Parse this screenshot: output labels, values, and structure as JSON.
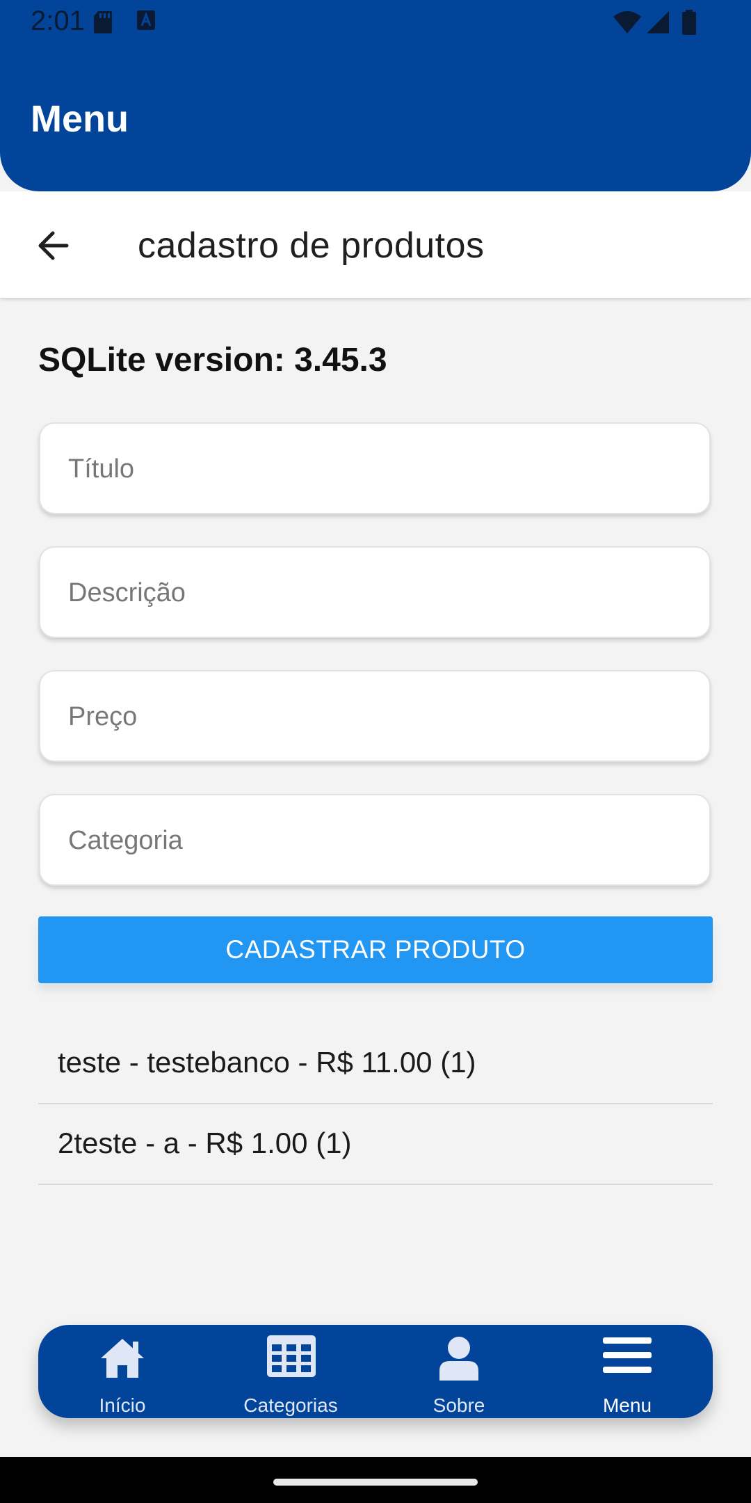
{
  "status_bar": {
    "time": "2:01"
  },
  "header": {
    "title": "Menu"
  },
  "toolbar": {
    "title": "cadastro de produtos"
  },
  "version_text": "SQLite version: 3.45.3",
  "form": {
    "titulo_placeholder": "Título",
    "descricao_placeholder": "Descrição",
    "preco_placeholder": "Preço",
    "categoria_placeholder": "Categoria",
    "submit_label": "CADASTRAR PRODUTO"
  },
  "products": [
    "teste - testebanco - R$ 11.00 (1)",
    "2teste - a - R$ 1.00 (1)"
  ],
  "tabs": [
    {
      "label": "Início",
      "icon": "home-icon"
    },
    {
      "label": "Categorias",
      "icon": "grid-icon"
    },
    {
      "label": "Sobre",
      "icon": "person-icon"
    },
    {
      "label": "Menu",
      "icon": "menu-icon"
    }
  ],
  "colors": {
    "primary": "#01449a",
    "button": "#2196f3",
    "background": "#f3f3f3"
  }
}
